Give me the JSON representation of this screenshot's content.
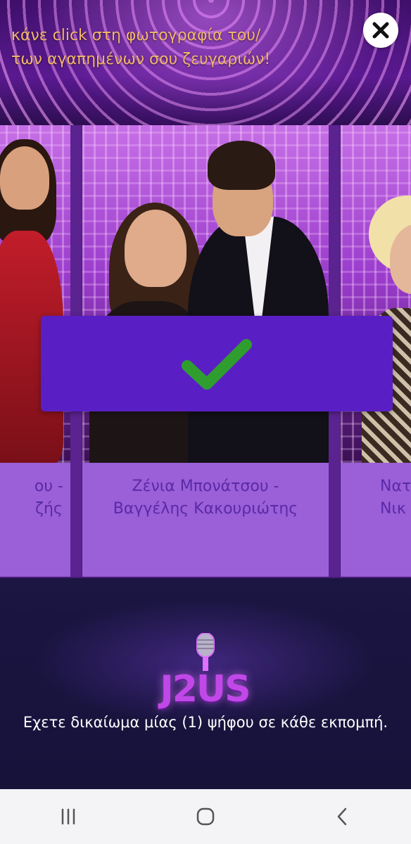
{
  "header": {
    "instruction": "κάνε click στη φωτογραφία του/των αγαπημένων σου ζευγαριών!",
    "close_icon": "close-icon"
  },
  "carousel": {
    "cards": [
      {
        "caption_line1": "ου -",
        "caption_line2": "ζής",
        "selected": false
      },
      {
        "caption_line1": "Ζένια Μπονάτσου -",
        "caption_line2": "Βαγγέλης Κακουριώτης",
        "selected": true
      },
      {
        "caption_line1": "Νατ",
        "caption_line2": "Νικ",
        "selected": false
      }
    ],
    "selected_icon": "check-icon"
  },
  "logo": {
    "text": "J2US"
  },
  "footer": {
    "note": "Εχετε δικαίωμα μίας (1) ψήφου σε κάθε εκπομπή."
  },
  "system_nav": {
    "recent_icon": "recent-apps-icon",
    "home_icon": "home-icon",
    "back_icon": "back-icon"
  },
  "colors": {
    "accent": "#5a1fc4",
    "caption_bg": "#9b5fd8",
    "caption_text": "#5a2aa6",
    "instruction_text": "#f2b56b",
    "check": "#2f9e2f"
  }
}
